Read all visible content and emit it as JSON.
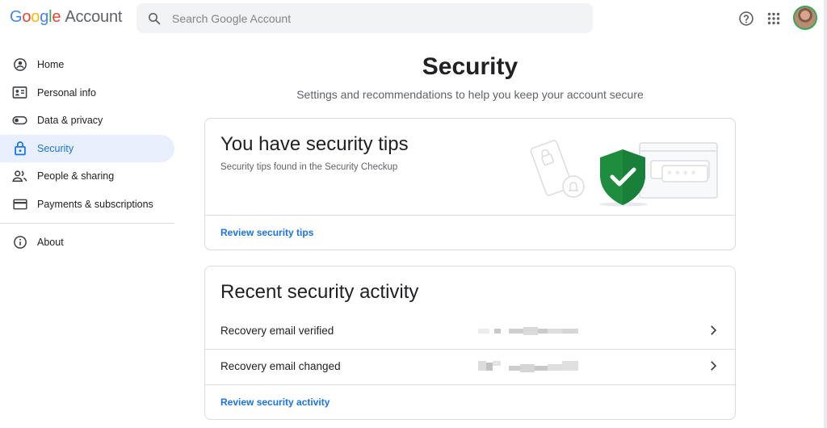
{
  "header": {
    "logo": {
      "G": "G",
      "o1": "o",
      "o2": "o",
      "g": "g",
      "l": "l",
      "e": "e",
      "account": "Account"
    },
    "search_placeholder": "Search Google Account",
    "icons": [
      "search-icon",
      "help-icon",
      "apps-grid-icon",
      "avatar"
    ]
  },
  "sidebar": {
    "items": [
      {
        "label": "Home",
        "icon": "home-account-icon"
      },
      {
        "label": "Personal info",
        "icon": "id-card-icon"
      },
      {
        "label": "Data & privacy",
        "icon": "toggle-icon"
      },
      {
        "label": "Security",
        "icon": "lock-icon",
        "active": true
      },
      {
        "label": "People & sharing",
        "icon": "people-icon"
      },
      {
        "label": "Payments & subscriptions",
        "icon": "credit-card-icon"
      }
    ],
    "about": {
      "label": "About",
      "icon": "info-icon"
    }
  },
  "main": {
    "title": "Security",
    "subtitle": "Settings and recommendations to help you keep your account secure",
    "tips_card": {
      "title": "You have security tips",
      "description": "Security tips found in the Security Checkup",
      "link": "Review security tips"
    },
    "activity_card": {
      "title": "Recent security activity",
      "rows": [
        {
          "label": "Recovery email verified"
        },
        {
          "label": "Recovery email changed"
        }
      ],
      "link": "Review security activity"
    }
  },
  "colors": {
    "accent": "#1a73e8",
    "active_bg": "#e8f0fe",
    "shield_green": "#188038",
    "border": "#dadce0",
    "text_secondary": "#5f6368"
  }
}
